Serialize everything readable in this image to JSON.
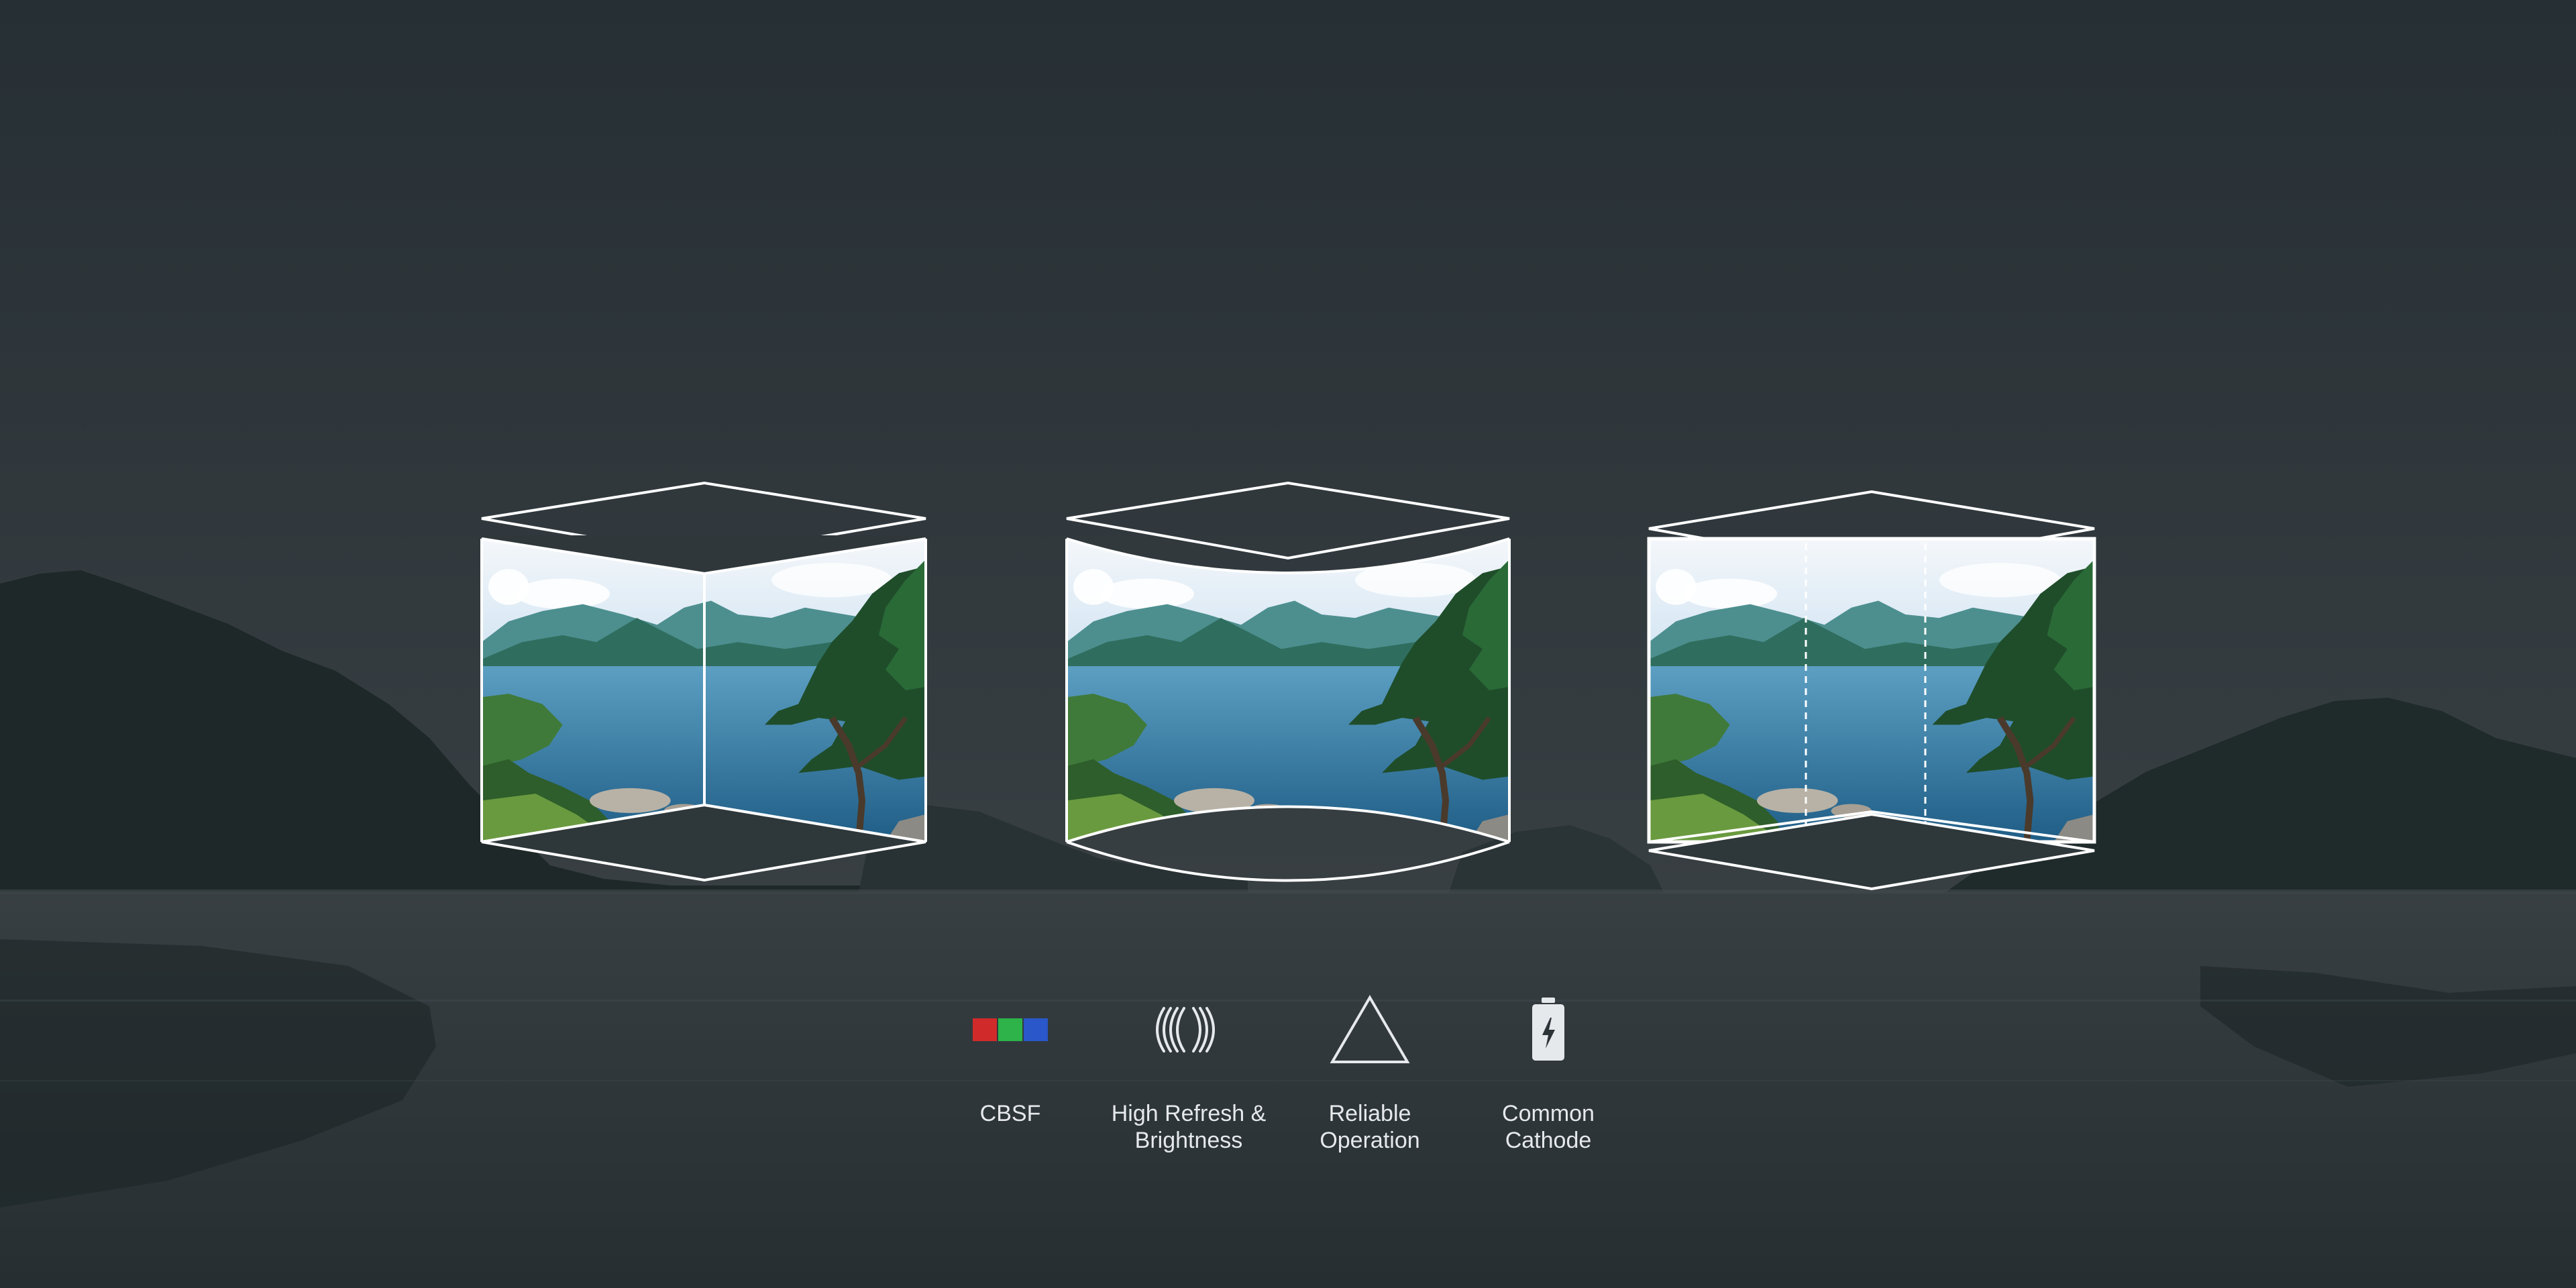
{
  "colors": {
    "sky_top": "#283136",
    "sky_horizon": "#353c40",
    "water": "#2d3438",
    "mountains": "#1f2a2c",
    "outline": "#ffffff",
    "text": "#e6e9eb",
    "cbsf_red": "#d12a2a",
    "cbsf_green": "#2db34a",
    "cbsf_blue": "#2a57c9"
  },
  "displays": [
    {
      "name": "angled-cube-display",
      "shape": "corner-fold"
    },
    {
      "name": "curved-display",
      "shape": "concave-curve"
    },
    {
      "name": "split-flat-display",
      "shape": "three-panel-flat"
    }
  ],
  "features": [
    {
      "icon": "rgb-subpixel-icon",
      "label": "CBSF"
    },
    {
      "icon": "refresh-waves-icon",
      "label": "High Refresh &\nBrightness"
    },
    {
      "icon": "triangle-icon",
      "label": "Reliable\nOperation"
    },
    {
      "icon": "battery-bolt-icon",
      "label": "Common\nCathode"
    }
  ]
}
